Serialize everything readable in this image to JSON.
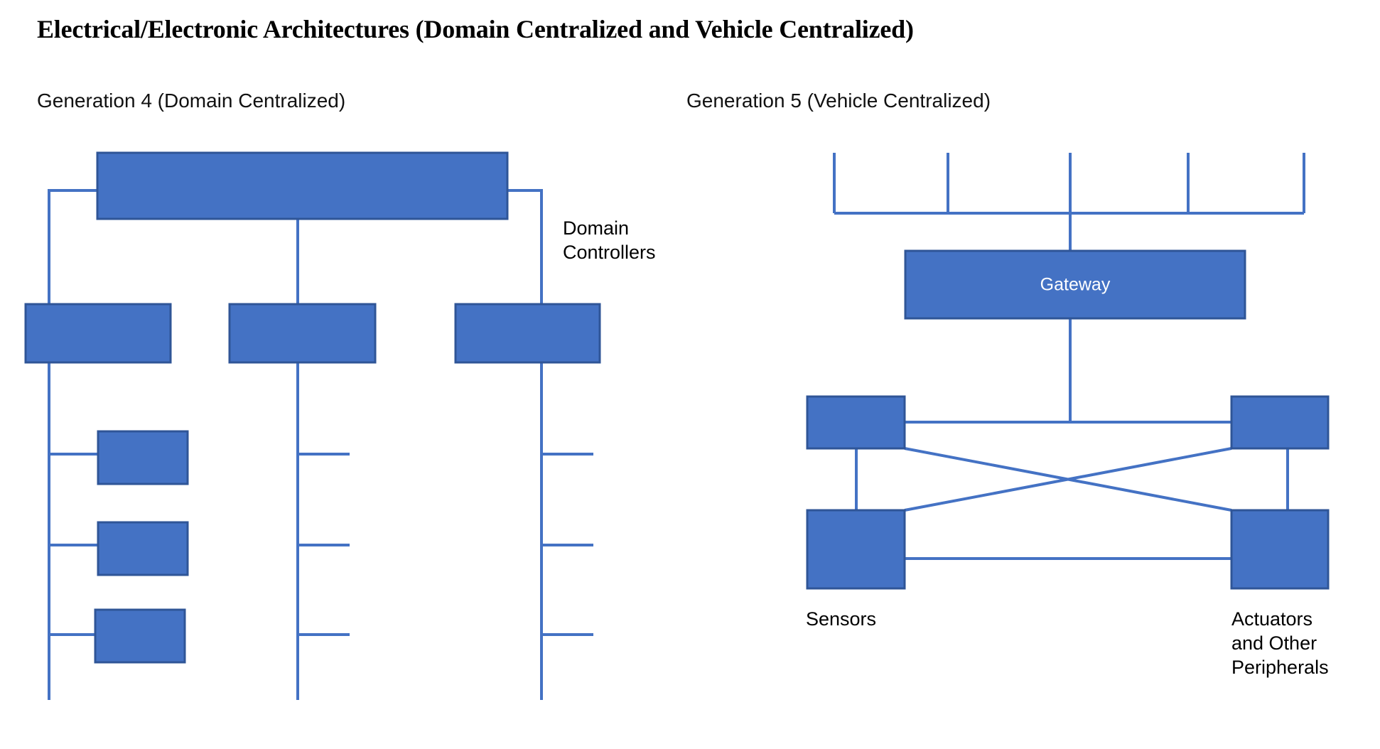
{
  "page": {
    "title": "Electrical/Electronic Architectures (Domain Centralized and Vehicle Centralized)",
    "background_color": "#FFFFFF"
  },
  "theme": {
    "node_fill": "#4472C4",
    "node_stroke": "#2F5597",
    "connector_color": "#4472C4",
    "node_text_color": "#FFFFFF",
    "label_text_color": "#000000"
  },
  "panels": [
    {
      "id": "generation-4",
      "title": "Generation 4 (Domain Centralized)",
      "nodes": {
        "central_unit": {
          "label": ""
        },
        "domain_controllers": [
          {
            "label": ""
          },
          {
            "label": ""
          },
          {
            "label": ""
          }
        ],
        "leaf_nodes": [
          {
            "label": ""
          },
          {
            "label": ""
          },
          {
            "label": ""
          }
        ]
      },
      "labels": [
        {
          "id": "domain-controllers",
          "text": "Domain\nControllers"
        }
      ]
    },
    {
      "id": "generation-5",
      "title": "Generation 5 (Vehicle Centralized)",
      "nodes": {
        "gateway": {
          "label": "Gateway"
        },
        "zone_controllers": [
          {
            "label": "",
            "position": "top-left"
          },
          {
            "label": "",
            "position": "top-right"
          },
          {
            "label": "",
            "position": "bottom-left"
          },
          {
            "label": "",
            "position": "bottom-right"
          }
        ]
      },
      "labels": [
        {
          "id": "sensors",
          "text": "Sensors"
        },
        {
          "id": "actuators",
          "text": "Actuators\nand Other\nPeripherals"
        }
      ]
    }
  ],
  "chart_data": {
    "type": "diagram",
    "title": "Electrical/Electronic Architectures (Domain Centralized and Vehicle Centralized)",
    "subcharts": [
      {
        "name": "Generation 4 (Domain Centralized)",
        "structure": "tree",
        "description": "One wide central block at top connected downward to three domain controller blocks; left controller branches to three small leaf blocks, center and right controllers branch to three stub connections each.",
        "node_counts": {
          "central": 1,
          "domain_controllers": 3,
          "leaf_boxes": 3,
          "stub_branches": 6
        }
      },
      {
        "name": "Generation 5 (Vehicle Centralized)",
        "structure": "bus-and-mesh",
        "description": "Top horizontal bus with five vertical drops feeds a Gateway block; gateway connects down to a four-node ring of zone controllers fully cross-connected (horizontal, vertical and both diagonals).",
        "node_counts": {
          "gateway": 1,
          "zone_controllers": 4,
          "bus_drops": 5
        }
      }
    ]
  }
}
